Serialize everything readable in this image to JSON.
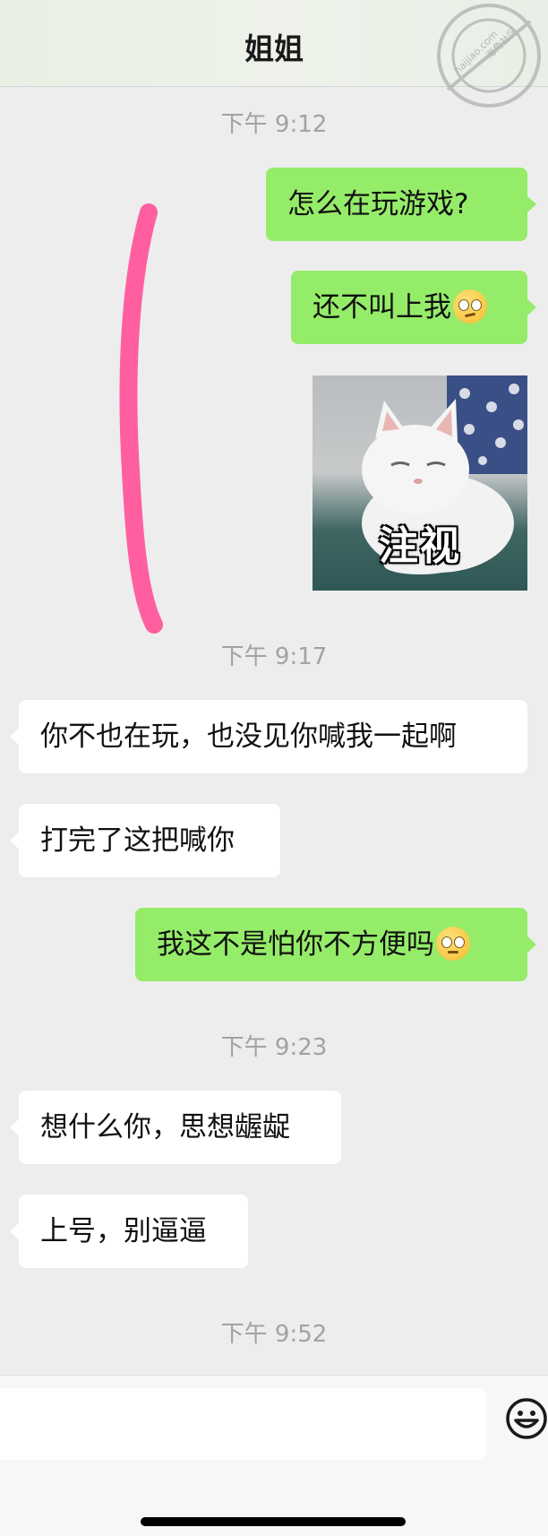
{
  "header": {
    "title": "姐姐"
  },
  "watermark": {
    "text_cn": "海角社区",
    "text_url": "haijiao.com"
  },
  "timestamps": [
    "下午 9:12",
    "下午 9:17",
    "下午 9:23",
    "下午 9:52"
  ],
  "messages": [
    {
      "sender": "me",
      "text": "怎么在玩游戏?"
    },
    {
      "sender": "me",
      "text": "还不叫上我",
      "emoji": "woozy-face-emoji"
    },
    {
      "sender": "me",
      "type": "sticker",
      "caption": "注视"
    },
    {
      "sender": "them",
      "text": "你不也在玩，也没见你喊我一起啊"
    },
    {
      "sender": "them",
      "text": "打完了这把喊你"
    },
    {
      "sender": "me",
      "text": "我这不是怕你不方便吗",
      "emoji": "pleading-face-emoji"
    },
    {
      "sender": "them",
      "text": "想什么你，思想龌龊"
    },
    {
      "sender": "them",
      "text": "上号，别逼逼"
    }
  ],
  "input": {
    "placeholder": ""
  },
  "colors": {
    "my_bubble": "#95ec69",
    "their_bubble": "#ffffff",
    "background": "#ededed",
    "annotation_stroke": "#ff5fa0"
  }
}
